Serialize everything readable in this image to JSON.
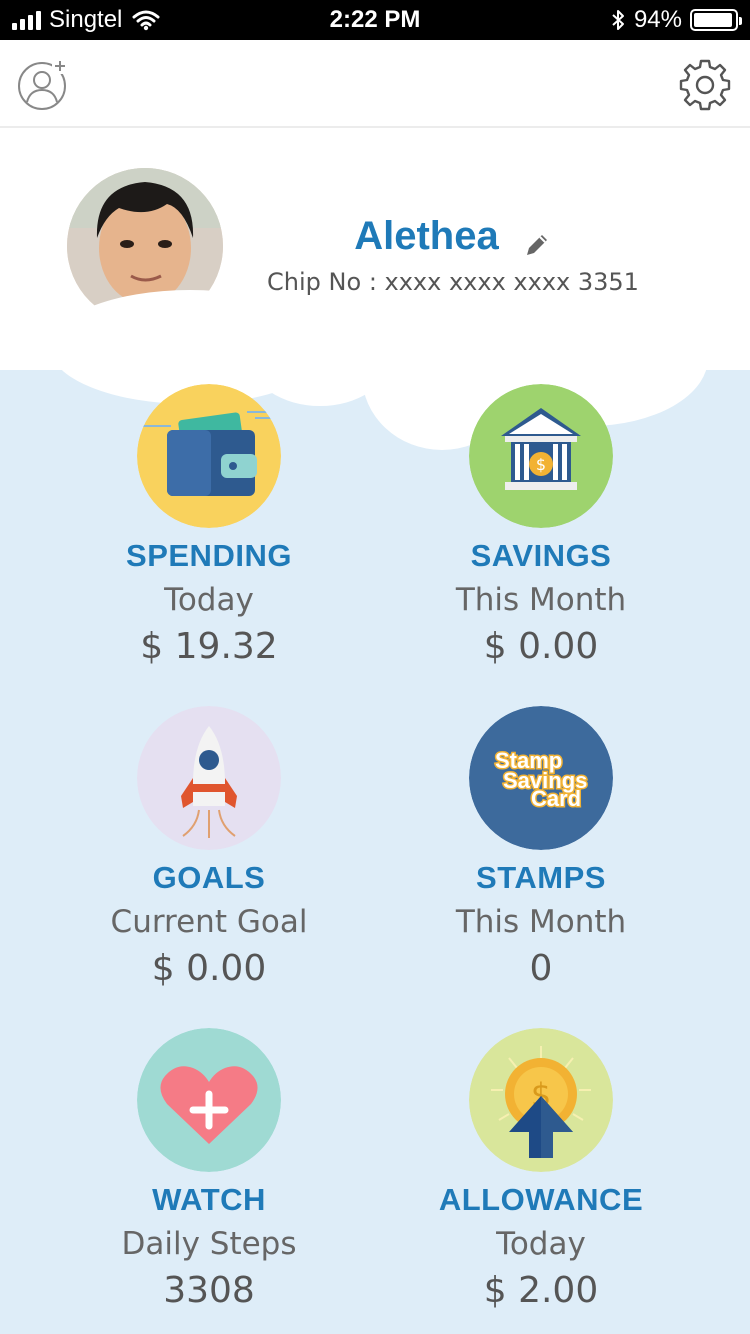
{
  "status_bar": {
    "carrier": "Singtel",
    "time": "2:22 PM",
    "battery_text": "94%",
    "battery_level": 0.94
  },
  "profile": {
    "name": "Alethea",
    "chip_no": "Chip No : xxxx xxxx xxxx 3351"
  },
  "tiles": [
    {
      "title": "SPENDING",
      "subtitle": "Today",
      "value": "$ 19.32",
      "color": "#f9d25d"
    },
    {
      "title": "SAVINGS",
      "subtitle": "This Month",
      "value": "$ 0.00",
      "color": "#9ed36e"
    },
    {
      "title": "GOALS",
      "subtitle": "Current Goal",
      "value": "$ 0.00",
      "color": "#e5e0f1"
    },
    {
      "title": "STAMPS",
      "subtitle": "This Month",
      "value": "0",
      "color": "#3d6a9c"
    },
    {
      "title": "WATCH",
      "subtitle": "Daily Steps",
      "value": "3308",
      "color": "#9fdad3"
    },
    {
      "title": "ALLOWANCE",
      "subtitle": "Today",
      "value": "$ 2.00",
      "color": "#d9e69b"
    }
  ],
  "stamp_card_text": [
    "Stamp",
    "Savings",
    "Card"
  ],
  "colors": {
    "accent": "#1f7ab8",
    "sky": "#deedf8"
  }
}
